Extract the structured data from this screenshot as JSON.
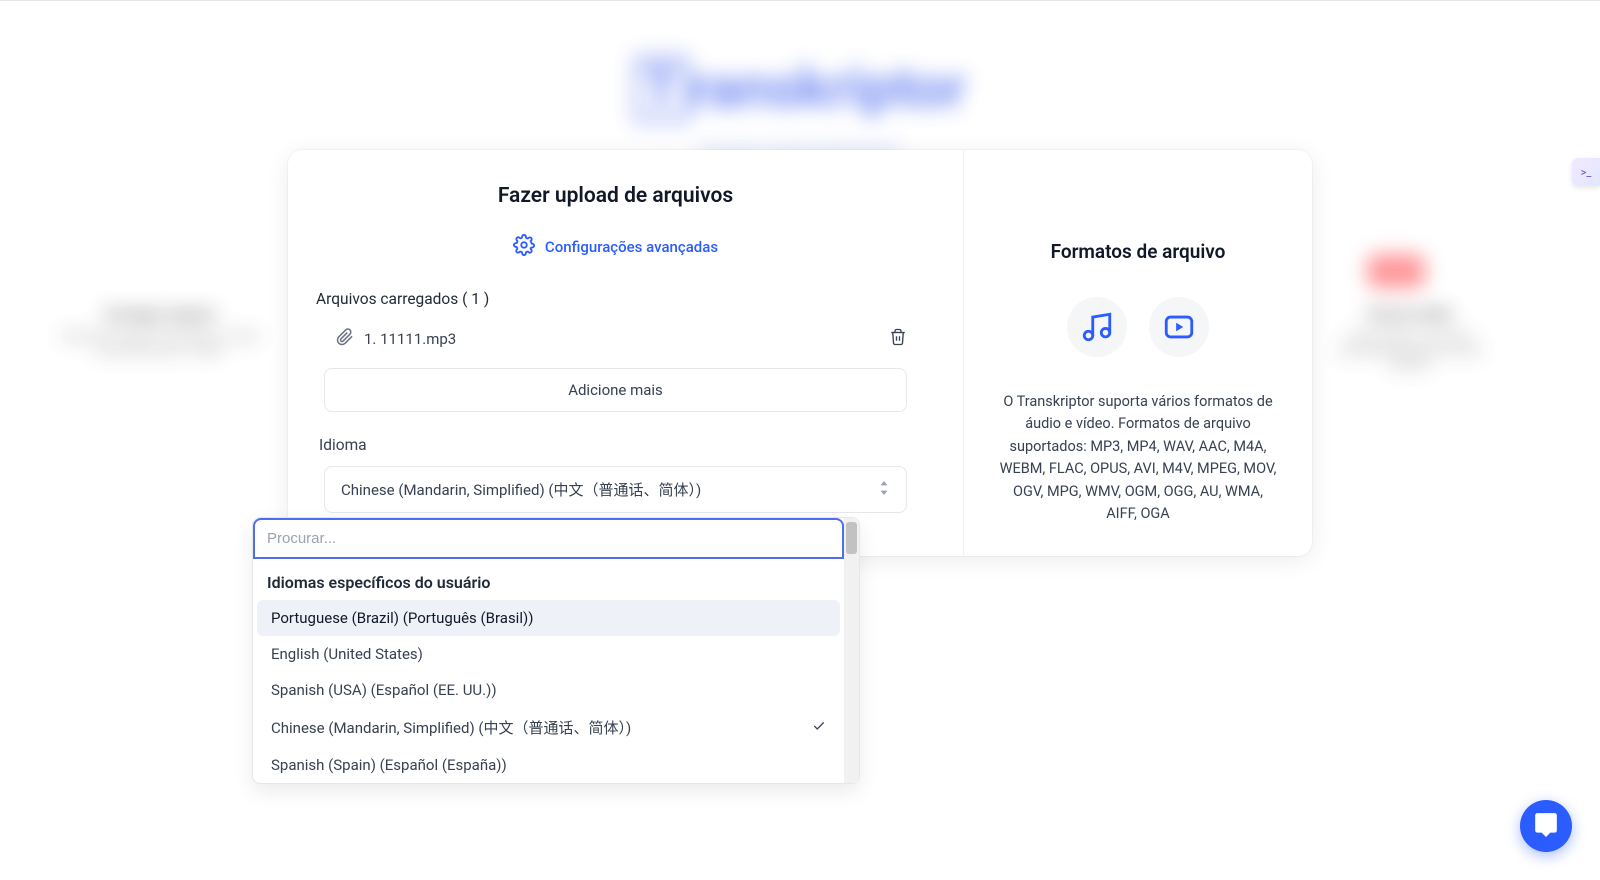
{
  "background": {
    "logo": "Transkriptor",
    "sideTextLeft": {
      "heading": "Carregar",
      "body": "raw background text"
    },
    "sideTextRight": {
      "heading": "ao audio",
      "body": "raw background text"
    }
  },
  "modal": {
    "title": "Fazer upload de arquivos",
    "advancedSettings": "Configurações avançadas",
    "uploadedLabel": "Arquivos carregados ( 1 )",
    "file": {
      "name": "1. 11111.mp3"
    },
    "addMore": "Adicione mais",
    "languageLabel": "Idioma",
    "selectedLanguage": "Chinese (Mandarin, Simplified) (中文（普通话、简体）)"
  },
  "dropdown": {
    "searchPlaceholder": "Procurar...",
    "sectionTitle": "Idiomas específicos do usuário",
    "items": [
      {
        "label": "Portuguese (Brazil) (Português (Brasil))",
        "highlighted": true,
        "selected": false
      },
      {
        "label": "English (United States)",
        "highlighted": false,
        "selected": false
      },
      {
        "label": "Spanish (USA) (Español (EE. UU.))",
        "highlighted": false,
        "selected": false
      },
      {
        "label": "Chinese (Mandarin, Simplified) (中文（普通话、简体）)",
        "highlighted": false,
        "selected": true
      },
      {
        "label": "Spanish (Spain) (Español (España))",
        "highlighted": false,
        "selected": false
      }
    ]
  },
  "sidebar": {
    "title": "Formatos de arquivo",
    "description": "O Transkriptor suporta vários formatos de áudio e vídeo. Formatos de arquivo suportados: MP3, MP4, WAV, AAC, M4A, WEBM, FLAC, OPUS, AVI, M4V, MPEG, MOV, OGV, MPG, WMV, OGM, OGG, AU, WMA, AIFF, OGA"
  },
  "edgeBadge": ">_",
  "chatFab": "chat"
}
